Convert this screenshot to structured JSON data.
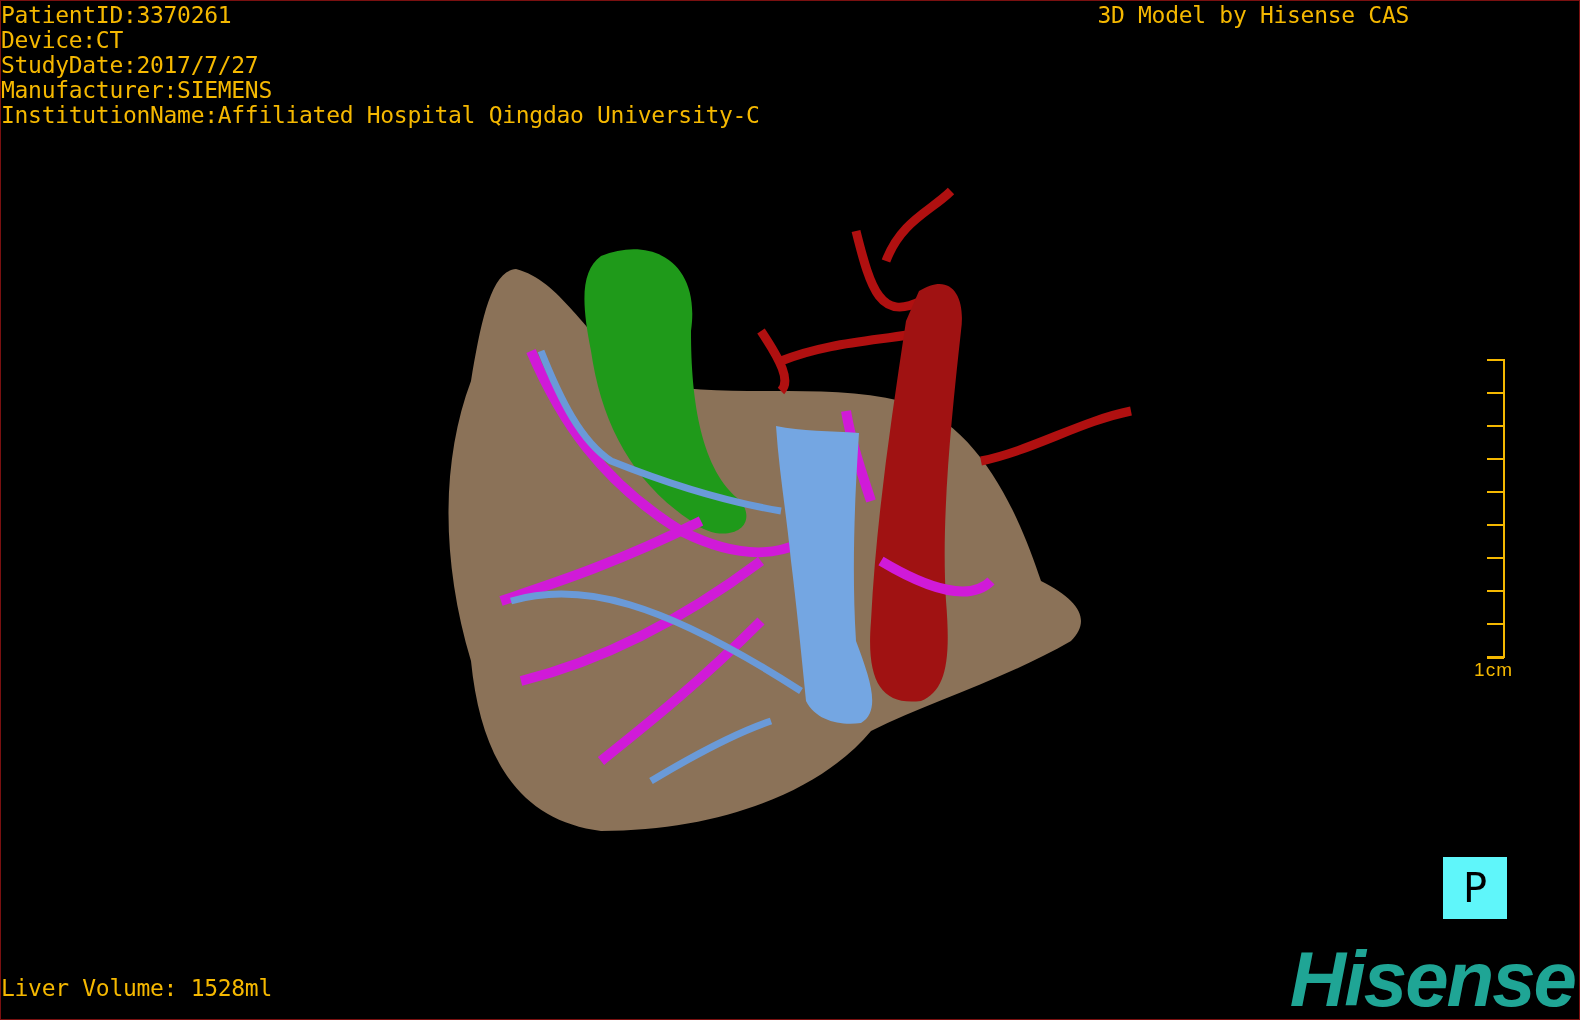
{
  "patient_info": [
    "PatientID:3370261",
    "Device:CT",
    "StudyDate:2017/7/27",
    "Manufacturer:SIEMENS",
    "InstitutionName:Affiliated Hospital Qingdao University-C"
  ],
  "title": "3D Model by Hisense CAS",
  "scale_bar": {
    "label": "1cm"
  },
  "orientation_marker": "P",
  "logo": "Hisense",
  "liver_volume": "Liver Volume: 1528ml"
}
